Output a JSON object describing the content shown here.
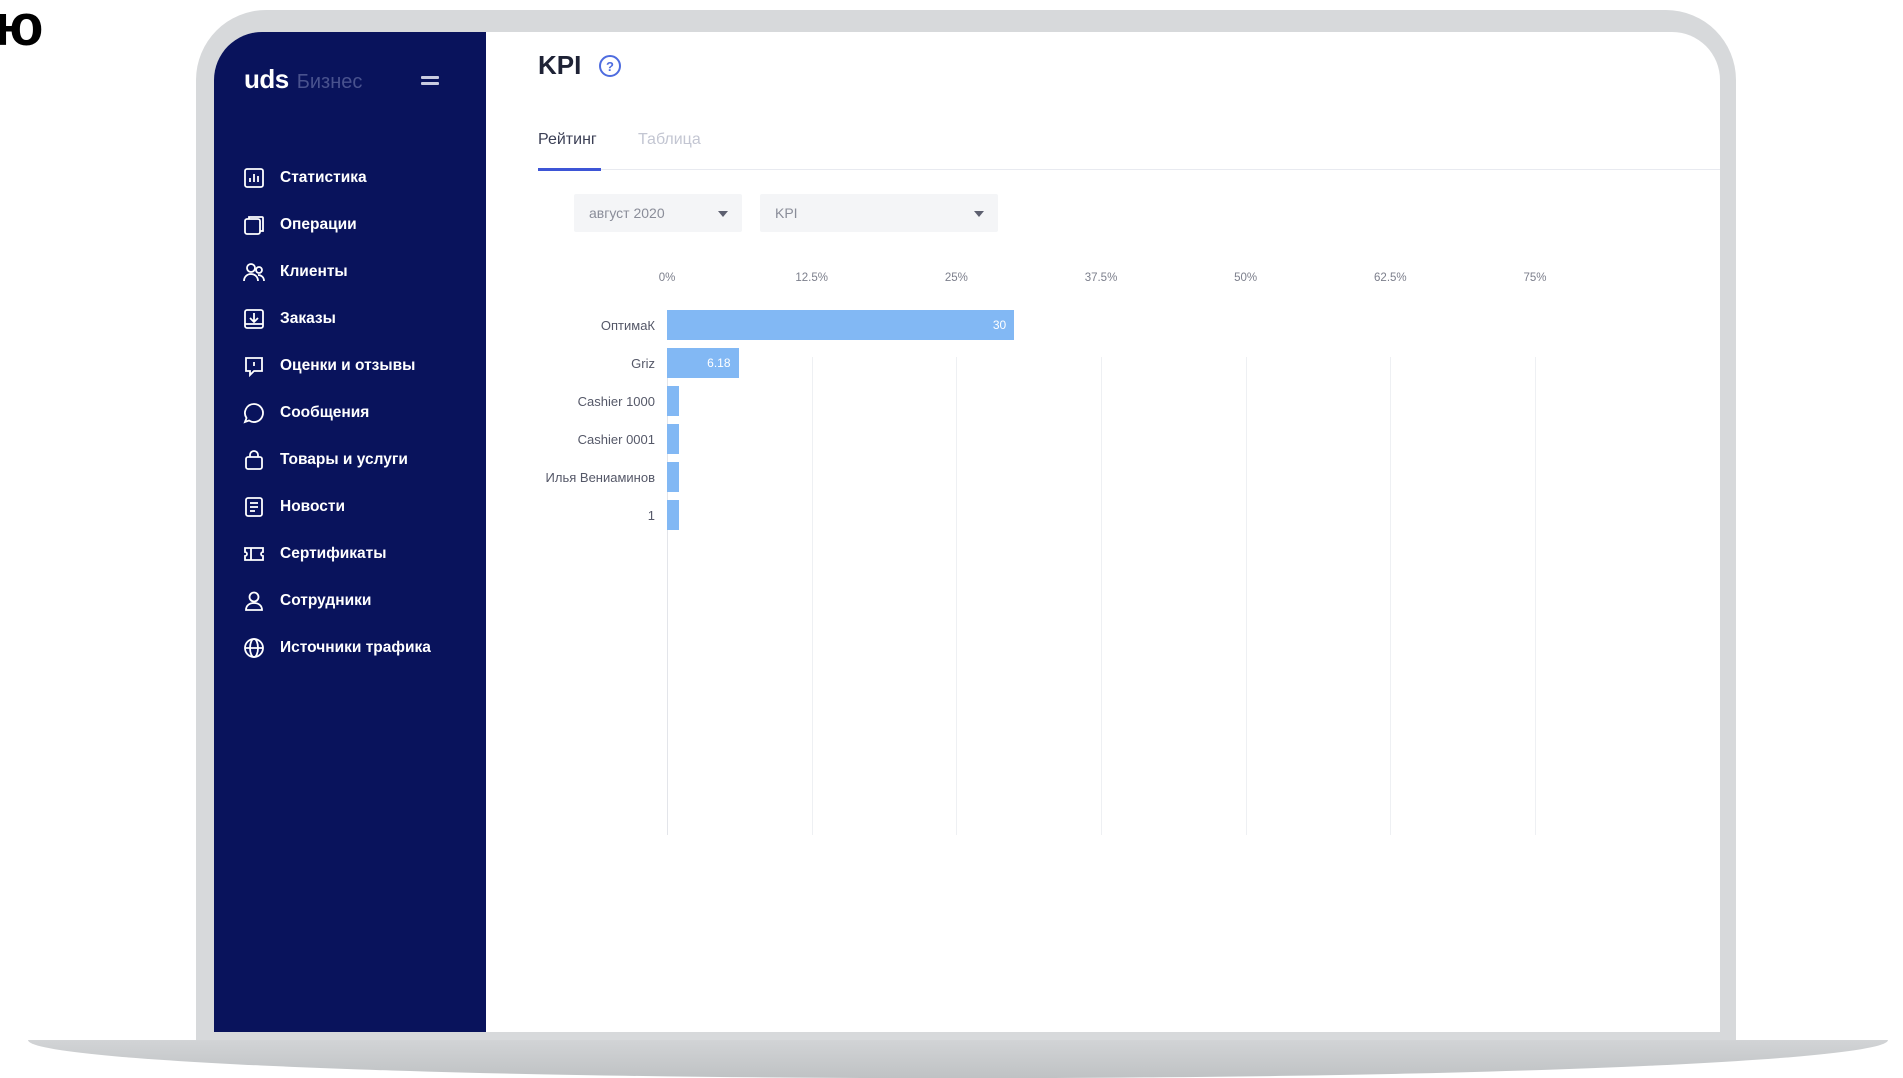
{
  "corner_text": "ю",
  "brand": {
    "logo": "uds",
    "subtitle": "Бизнес"
  },
  "sidebar": {
    "items": [
      {
        "label": "Статистика",
        "icon": "chart-icon"
      },
      {
        "label": "Операции",
        "icon": "operations-icon"
      },
      {
        "label": "Клиенты",
        "icon": "clients-icon"
      },
      {
        "label": "Заказы",
        "icon": "orders-icon"
      },
      {
        "label": "Оценки и отзывы",
        "icon": "reviews-icon"
      },
      {
        "label": "Сообщения",
        "icon": "messages-icon"
      },
      {
        "label": "Товары и услуги",
        "icon": "bag-icon"
      },
      {
        "label": "Новости",
        "icon": "news-icon"
      },
      {
        "label": "Сертификаты",
        "icon": "certificate-icon"
      },
      {
        "label": "Сотрудники",
        "icon": "user-icon"
      },
      {
        "label": "Источники трафика",
        "icon": "globe-icon"
      }
    ]
  },
  "page": {
    "title": "KPI",
    "help": "?"
  },
  "tabs": [
    {
      "label": "Рейтинг",
      "active": true
    },
    {
      "label": "Таблица",
      "active": false
    }
  ],
  "filters": {
    "period": "август 2020",
    "metric": "KPI"
  },
  "colors": {
    "sidebar": "#09135c",
    "accent": "#3d55d6",
    "bar": "#82b8f4"
  },
  "chart_data": {
    "type": "bar",
    "orientation": "horizontal",
    "categories": [
      "ОптимаК",
      "Griz",
      "Cashier 1000",
      "Cashier 0001",
      "Илья Вениаминов",
      "1"
    ],
    "values": [
      30,
      6.18,
      1,
      1,
      1,
      1
    ],
    "value_labels": [
      "30",
      "6.18",
      "",
      "",
      "",
      ""
    ],
    "xticks": [
      "0%",
      "12.5%",
      "25%",
      "37.5%",
      "50%",
      "62.5%",
      "75%"
    ],
    "xlim": [
      0,
      75
    ],
    "grid": true
  }
}
